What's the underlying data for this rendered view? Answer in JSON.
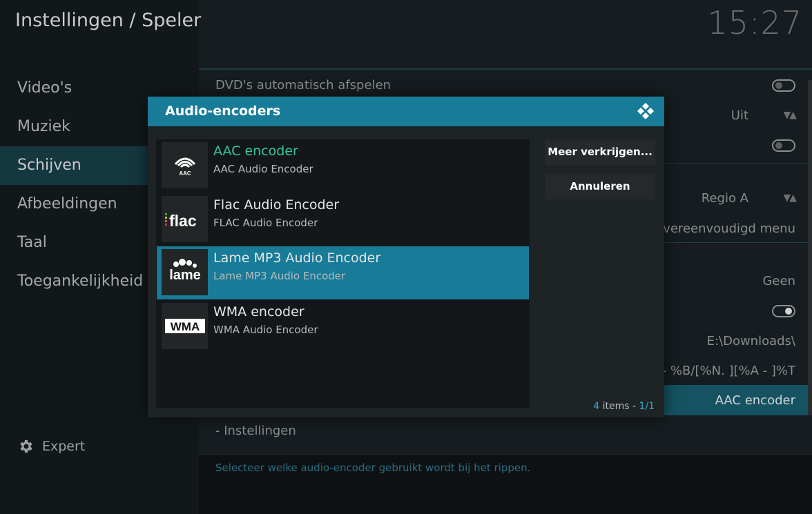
{
  "header": {
    "title": "Instellingen / Speler",
    "clock": "15:27"
  },
  "sidebar": {
    "items": [
      {
        "label": "Video's"
      },
      {
        "label": "Muziek"
      },
      {
        "label": "Schijven"
      },
      {
        "label": "Afbeeldingen"
      },
      {
        "label": "Taal"
      },
      {
        "label": "Toegankelijkheid"
      }
    ],
    "active_index": 2,
    "expert_label": "Expert"
  },
  "settings": {
    "dvd_autoplay": "DVD's automatisch afspelen",
    "uit": "Uit",
    "regio": "Regio A",
    "simplified": "n vereenvoudigd menu",
    "geen": "Geen",
    "path": "E:\\Downloads\\",
    "format": "A - %B/[%N. ][%A - ]%T",
    "encoder_value": "AAC encoder",
    "instellingen": "- Instellingen",
    "hint": "Selecteer welke audio-encoder gebruikt wordt bij het rippen."
  },
  "dialog": {
    "title": "Audio-encoders",
    "items": [
      {
        "title": "AAC encoder",
        "subtitle": "AAC Audio Encoder",
        "logo": "AAC"
      },
      {
        "title": "Flac Audio Encoder",
        "subtitle": "FLAC Audio Encoder",
        "logo": "flac"
      },
      {
        "title": "Lame MP3 Audio Encoder",
        "subtitle": "Lame MP3 Audio Encoder",
        "logo": "lame"
      },
      {
        "title": "WMA encoder",
        "subtitle": "WMA Audio Encoder",
        "logo": "WMA"
      }
    ],
    "buttons": {
      "more": "Meer verkrijgen...",
      "cancel": "Annuleren"
    },
    "count": {
      "num": "4",
      "items_label": " items - ",
      "page": "1/1"
    }
  },
  "colors": {
    "accent": "#187b98",
    "current": "#37c99a",
    "sidebar_active": "#15373f"
  }
}
